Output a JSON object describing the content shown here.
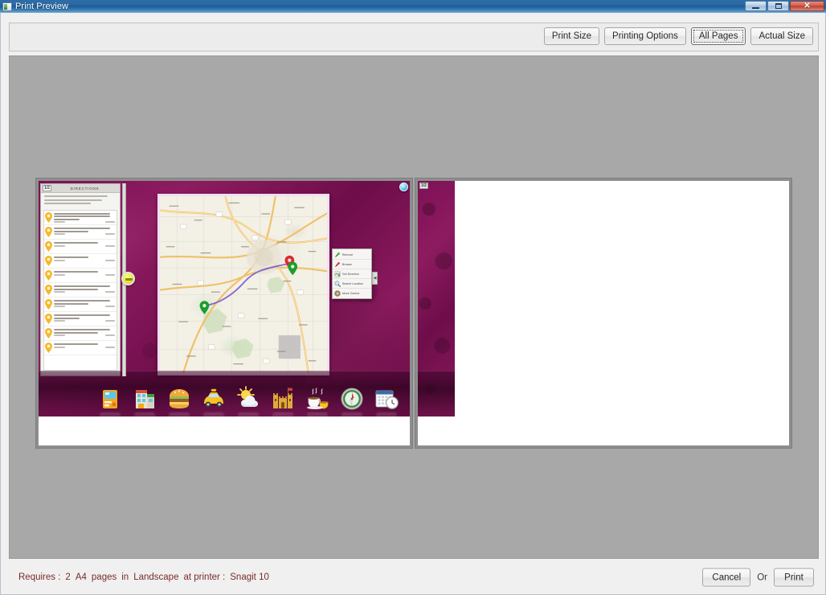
{
  "window": {
    "title": "Print Preview",
    "icon": "print-preview-icon",
    "controls": {
      "minimize": "–",
      "maximize": "□",
      "close": "✕"
    }
  },
  "toolbar": {
    "buttons": [
      {
        "label": "Print Size",
        "name": "print-size-button",
        "focused": false
      },
      {
        "label": "Printing Options",
        "name": "printing-options-button",
        "focused": false
      },
      {
        "label": "All Pages",
        "name": "all-pages-button",
        "focused": true
      },
      {
        "label": "Actual Size",
        "name": "actual-size-button",
        "focused": false
      }
    ]
  },
  "preview": {
    "pages": [
      {
        "number": "1/2",
        "label": "page-1"
      },
      {
        "number": "1/2",
        "label": "page-2"
      }
    ],
    "page1": {
      "directions_panel": {
        "page_indicator": "1/2",
        "title": "DIRECTIONS",
        "steps_count": 10
      },
      "map": {
        "route_color": "#6a4fc4",
        "start_marker_color": "#1f9c2f",
        "end_marker_color": "#d92b2b",
        "background_color": "#f3f0e6"
      },
      "context_menu": {
        "items": [
          {
            "label": "Remove",
            "icon": "green-pin-icon"
          },
          {
            "label": "Browse",
            "icon": "red-pin-icon"
          },
          {
            "label": "Get Direction",
            "icon": "directions-icon"
          },
          {
            "label": "Search Location",
            "icon": "magnifier-icon"
          },
          {
            "label": "Move Control",
            "icon": "move-control-icon"
          }
        ],
        "collapse_tab": "◀"
      },
      "dock": {
        "icons": [
          "atm-icon",
          "shop-icon",
          "burger-icon",
          "taxi-icon",
          "weather-icon",
          "castle-icon",
          "cafe-icon",
          "compass-icon",
          "calendar-clock-icon"
        ]
      },
      "desktop_color": "#7d1055"
    }
  },
  "status": {
    "prefix": "Requires :",
    "page_count": "2",
    "paper_size": "A4",
    "pages_word": "pages",
    "in_word": "in",
    "orientation": "Landscape",
    "printer_prefix": "at printer :",
    "printer_name": "Snagit 10"
  },
  "footer": {
    "cancel_label": "Cancel",
    "or_label": "Or",
    "print_label": "Print"
  }
}
